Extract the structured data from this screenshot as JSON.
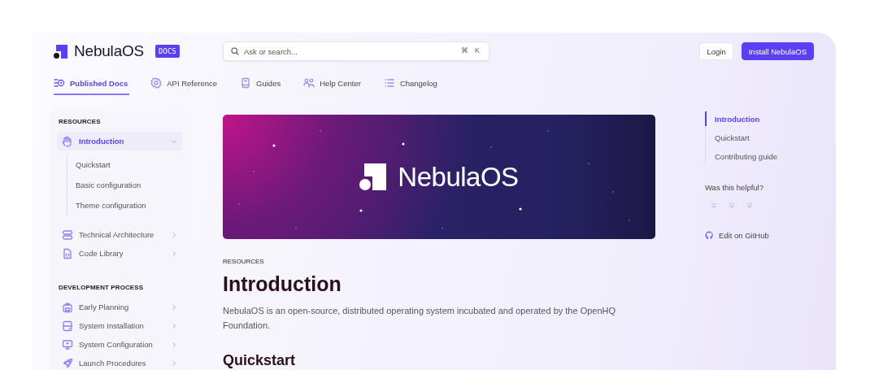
{
  "brand": {
    "name": "NebulaOS",
    "badge": "DOCS"
  },
  "search": {
    "placeholder": "Ask or search...",
    "keys": [
      "⌘",
      "K"
    ]
  },
  "header_buttons": [
    {
      "label": "Login",
      "kind": "secondary"
    },
    {
      "label": "Install NebulaOS",
      "kind": "primary"
    }
  ],
  "tabs": [
    {
      "label": "Published Docs",
      "selected": true
    },
    {
      "label": "API Reference",
      "selected": false
    },
    {
      "label": "Guides",
      "selected": false
    },
    {
      "label": "Help Center",
      "selected": false
    },
    {
      "label": "Changelog",
      "selected": false
    }
  ],
  "sidebar": {
    "sections": [
      {
        "title": "RESOURCES",
        "items": [
          {
            "label": "Introduction",
            "selected": true,
            "expanded": true,
            "children": [
              {
                "label": "Quickstart",
                "selected": false
              },
              {
                "label": "Basic configuration",
                "selected": false
              },
              {
                "label": "Theme configuration",
                "selected": false
              }
            ]
          },
          {
            "label": "Technical Architecture",
            "selected": false,
            "expanded": false
          },
          {
            "label": "Code Library",
            "selected": false,
            "expanded": false
          }
        ]
      },
      {
        "title": "DEVELOPMENT PROCESS",
        "items": [
          {
            "label": "Early Planning",
            "selected": false,
            "expanded": false
          },
          {
            "label": "System Installation",
            "selected": false,
            "expanded": false
          },
          {
            "label": "System Configuration",
            "selected": false,
            "expanded": false
          },
          {
            "label": "Launch Procedures",
            "selected": false,
            "expanded": false
          }
        ]
      }
    ]
  },
  "main": {
    "banner": {
      "text": "NebulaOS"
    },
    "eyebrow": "RESOURCES",
    "title": "Introduction",
    "intro": "NebulaOS is an open-source, distributed operating system incubated and operated by the OpenHQ Foundation.",
    "heading": "Quickstart"
  },
  "toc": {
    "items": [
      {
        "label": "Introduction",
        "selected": true
      },
      {
        "label": "Quickstart",
        "selected": false
      },
      {
        "label": "Contributing guide",
        "selected": false
      }
    ],
    "feedback": {
      "question": "Was this helpful?"
    },
    "edit_link": "Edit on GitHub"
  }
}
